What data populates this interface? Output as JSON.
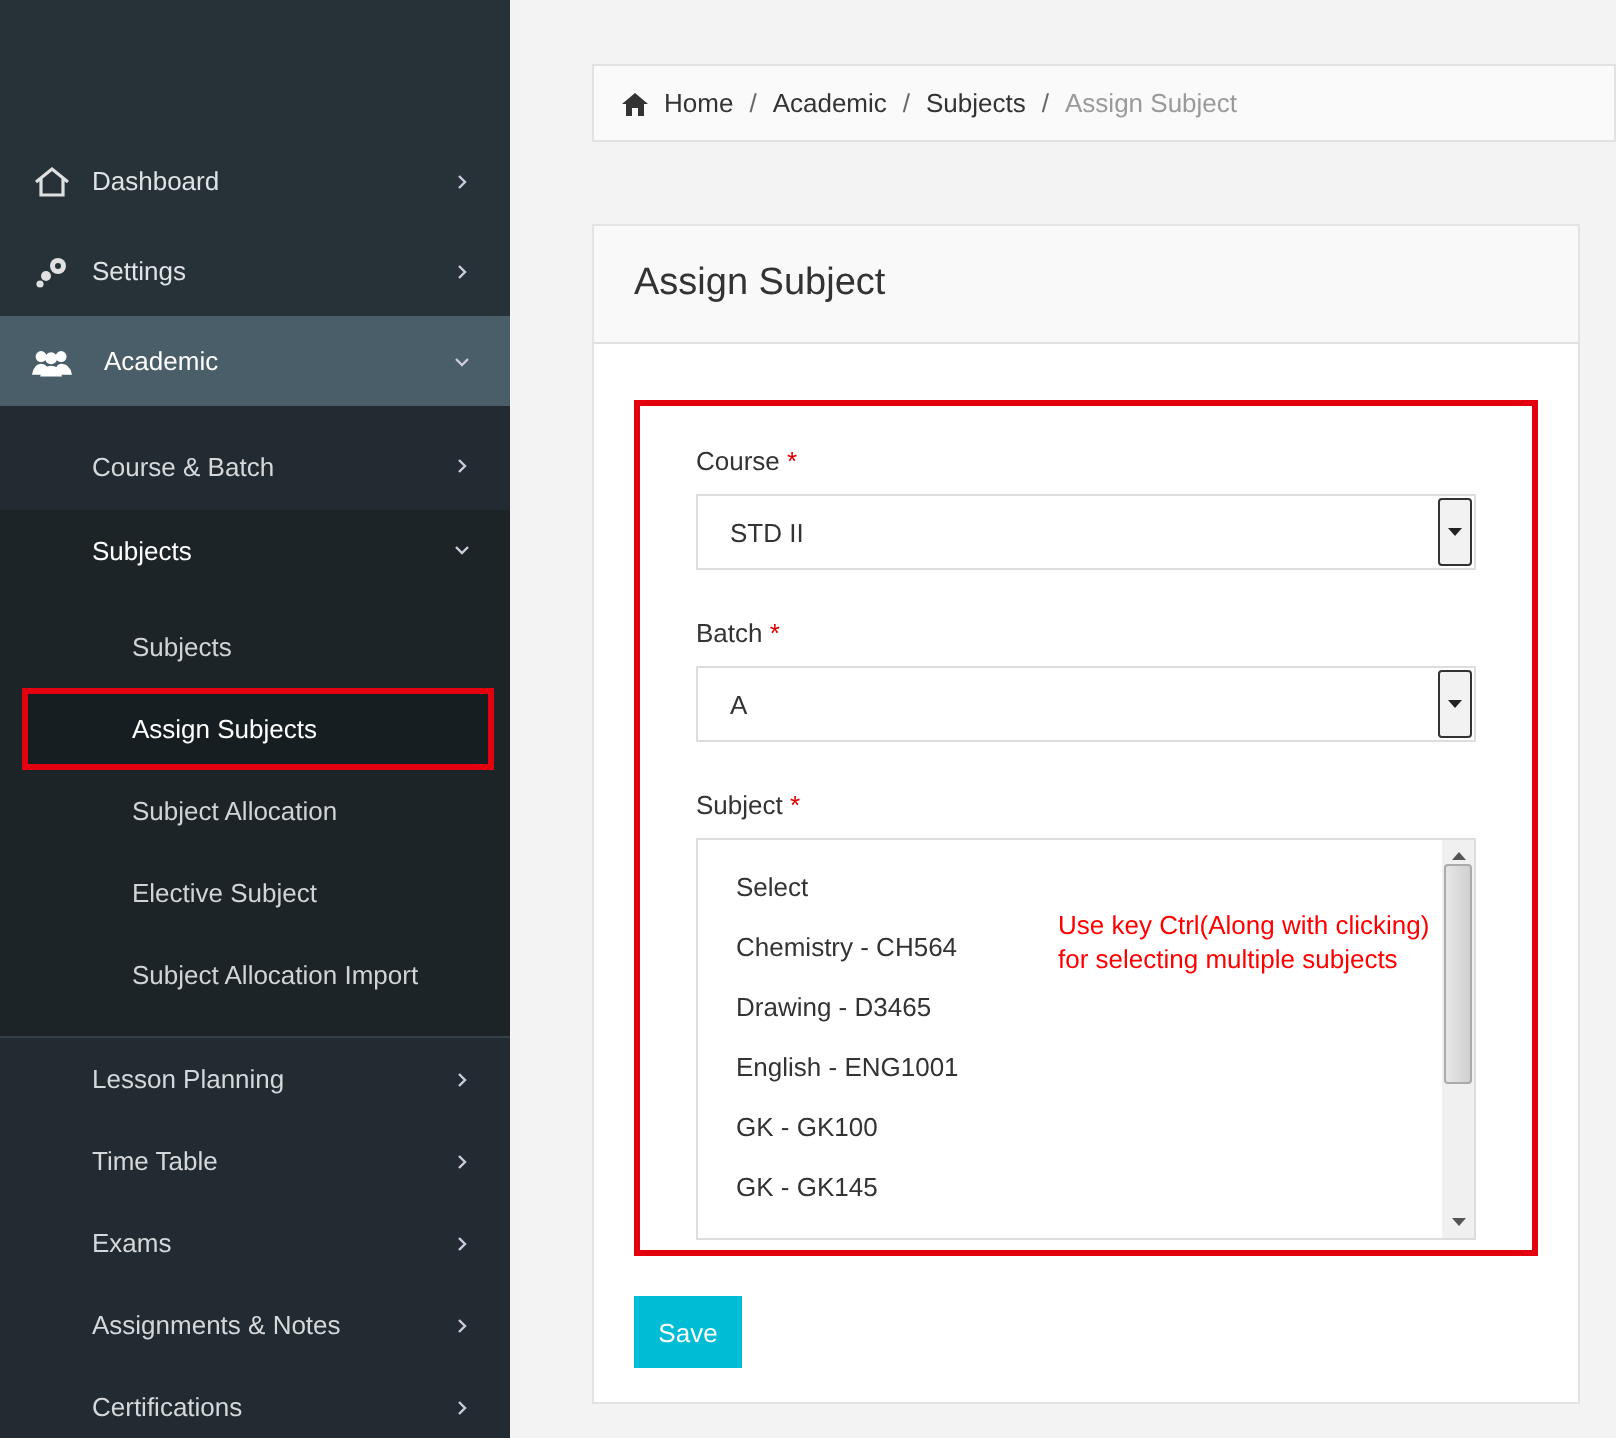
{
  "sidebar": {
    "items": [
      {
        "label": "Dashboard",
        "selected": false,
        "expanded": false
      },
      {
        "label": "Settings",
        "selected": false,
        "expanded": false
      },
      {
        "label": "Academic",
        "selected": true,
        "expanded": true,
        "children": [
          {
            "label": "Course & Batch",
            "expanded": false
          },
          {
            "label": "Subjects",
            "expanded": true,
            "children": [
              {
                "label": "Subjects",
                "selected": false,
                "highlighted": false
              },
              {
                "label": "Assign Subjects",
                "selected": true,
                "highlighted": true
              },
              {
                "label": "Subject Allocation",
                "selected": false,
                "highlighted": false
              },
              {
                "label": "Elective Subject",
                "selected": false,
                "highlighted": false
              },
              {
                "label": "Subject Allocation Import",
                "selected": false,
                "highlighted": false
              }
            ]
          },
          {
            "label": "Lesson Planning",
            "expanded": false
          },
          {
            "label": "Time Table",
            "expanded": false
          },
          {
            "label": "Exams",
            "expanded": false
          },
          {
            "label": "Assignments & Notes",
            "expanded": false
          },
          {
            "label": "Certifications",
            "expanded": false
          }
        ]
      }
    ]
  },
  "breadcrumb": {
    "separator": "/",
    "items": [
      "Home",
      "Academic",
      "Subjects",
      "Assign Subject"
    ]
  },
  "card": {
    "title": "Assign Subject",
    "highlighted": true,
    "fields": [
      {
        "kind": "select",
        "label": "Course",
        "required_mark": "*",
        "value": "STD II"
      },
      {
        "kind": "select",
        "label": "Batch",
        "required_mark": "*",
        "value": "A"
      },
      {
        "kind": "listbox",
        "label": "Subject",
        "required_mark": "*",
        "options": [
          "Select",
          "Chemistry - CH564",
          "Drawing - D3465",
          "English - ENG1001",
          "GK - GK100",
          "GK - GK145"
        ],
        "note": "Use key Ctrl(Along with clicking)\nfor selecting multiple subjects"
      }
    ],
    "button": "Save"
  }
}
